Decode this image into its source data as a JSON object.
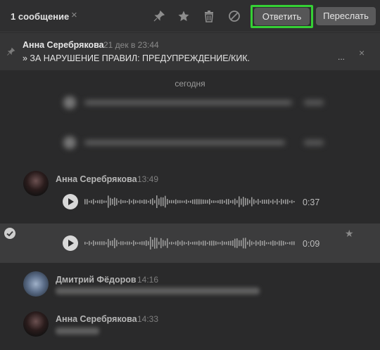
{
  "topbar": {
    "selection_count": "1 сообщение",
    "close_icon": "×",
    "icons": [
      "pin-icon",
      "star-icon",
      "trash-icon",
      "block-icon"
    ],
    "reply_label": "Ответить",
    "forward_label": "Переслать",
    "highlight_color": "#35d035"
  },
  "pinned": {
    "author": "Анна Серебрякова",
    "date": "21 дек в 23:44",
    "text": "» ЗА НАРУШЕНИЕ ПРАВИЛ: ПРЕДУПРЕЖДЕНИЕ/КИК.",
    "ellipsis": "...",
    "close_icon": "×"
  },
  "day_divider": "сегодня",
  "messages": [
    {
      "author": "Анна Серебрякова",
      "time": "13:49",
      "voice_duration": "0:37"
    },
    {
      "voice_duration": "0:09",
      "selected": true
    },
    {
      "author": "Дмитрий Фёдоров",
      "time": "14:16"
    },
    {
      "author": "Анна Серебрякова",
      "time": "14:33"
    }
  ]
}
